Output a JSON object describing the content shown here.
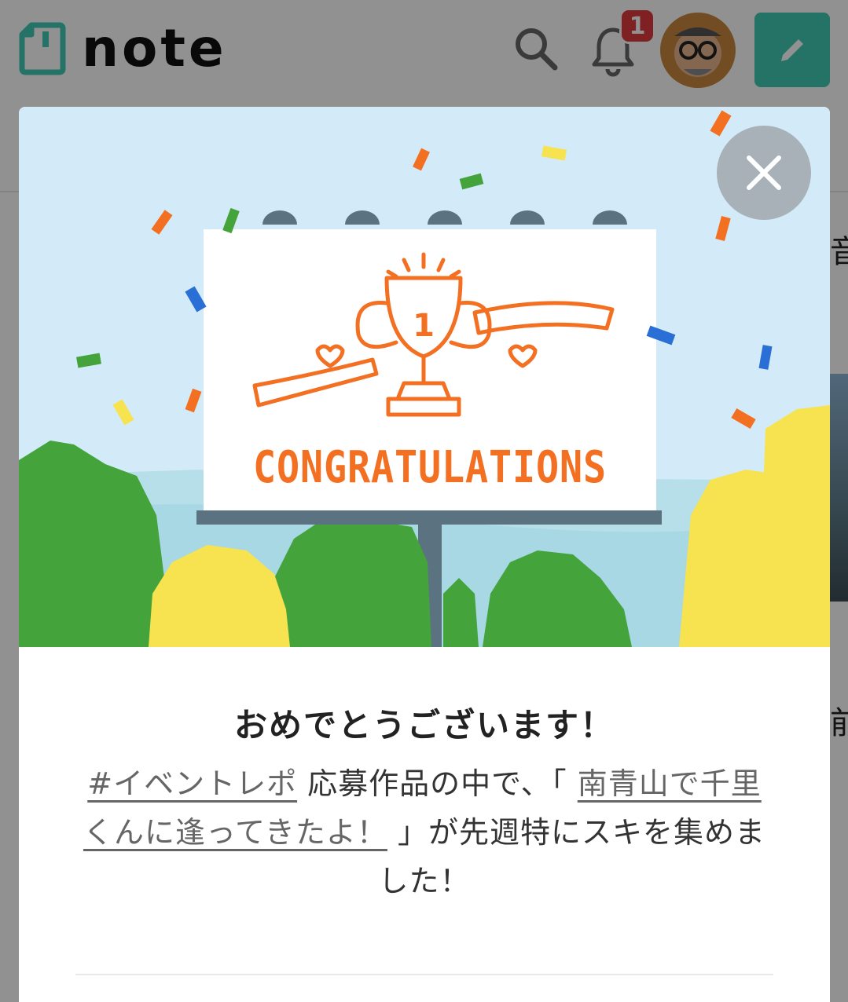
{
  "header": {
    "logo_text": "note",
    "notification_count": "1",
    "colors": {
      "brand": "#41c9b4",
      "badge": "#e0393e"
    }
  },
  "background": {
    "side_text_1": "音",
    "side_text_2": "前"
  },
  "modal": {
    "banner_text": "CONGRATULATIONS",
    "trophy_number": "1",
    "title": "おめでとうございます！",
    "hashtag_link": "#イベントレポ",
    "text_1": "応募作品の中で、「",
    "article_link": "南青山で千里くんに逢ってきたよ！",
    "text_2": "」が先週特にスキを集めました！",
    "colors": {
      "sky": "#d3ebf8",
      "accent_orange": "#f36f21",
      "tree_green": "#44a33b",
      "tree_yellow": "#f7e34f"
    }
  }
}
